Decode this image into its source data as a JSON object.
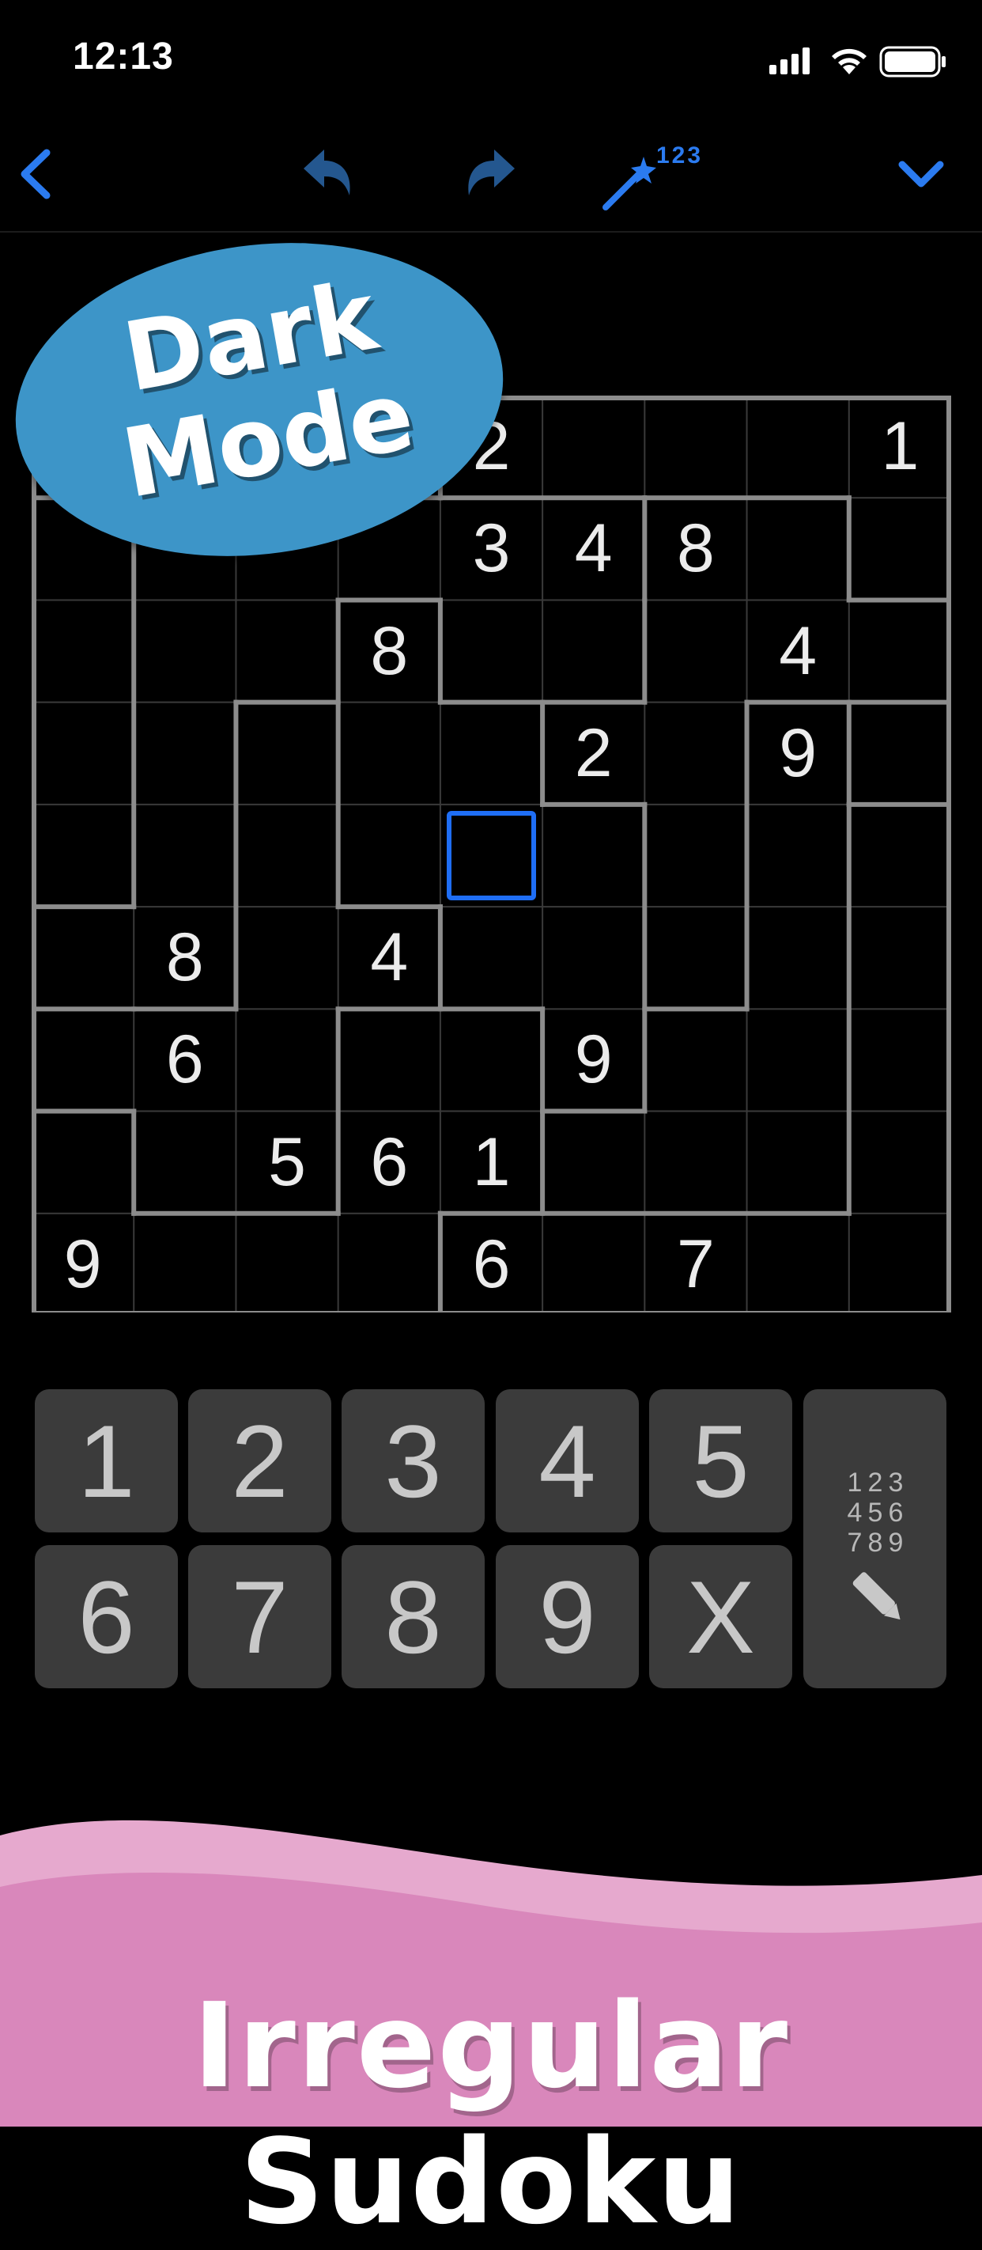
{
  "status_bar": {
    "time": "12:13"
  },
  "toolbar": {
    "back_icon": "chevron-left-icon",
    "undo_icon": "undo-arrow-icon",
    "redo_icon": "redo-arrow-icon",
    "hint_icon": "magic-wand-icon",
    "hint_label": "123",
    "collapse_icon": "chevron-down-icon",
    "accent_color": "#2b7bf0"
  },
  "badge": {
    "line1": "Dark",
    "line2": "Mode",
    "color": "#3d95c8"
  },
  "grid": {
    "rows": [
      [
        "",
        "",
        "",
        "",
        "2",
        "",
        "",
        "",
        "1"
      ],
      [
        "",
        "",
        "",
        "",
        "3",
        "4",
        "8",
        "",
        ""
      ],
      [
        "",
        "",
        "",
        "8",
        "",
        "",
        "",
        "4",
        ""
      ],
      [
        "",
        "",
        "",
        "",
        "",
        "2",
        "",
        "9",
        ""
      ],
      [
        "",
        "",
        "",
        "",
        "",
        "",
        "",
        "",
        ""
      ],
      [
        "",
        "8",
        "",
        "4",
        "",
        "",
        "",
        "",
        ""
      ],
      [
        "",
        "6",
        "",
        "",
        "",
        "9",
        "",
        "",
        ""
      ],
      [
        "",
        "",
        "5",
        "6",
        "1",
        "",
        "",
        "",
        ""
      ],
      [
        "9",
        "",
        "",
        "",
        "6",
        "",
        "7",
        "",
        ""
      ]
    ],
    "selected": {
      "row": 4,
      "col": 4
    },
    "selection_color": "#1f6ef5"
  },
  "keypad": {
    "keys": [
      "1",
      "2",
      "3",
      "4",
      "5",
      "6",
      "7",
      "8",
      "9",
      "X"
    ],
    "pencil_digits": [
      "1",
      "2",
      "3",
      "4",
      "5",
      "6",
      "7",
      "8",
      "9"
    ],
    "pencil_icon": "pencil-icon"
  },
  "footer": {
    "title": "Irregular Sudoku",
    "color": "#d987bb"
  }
}
